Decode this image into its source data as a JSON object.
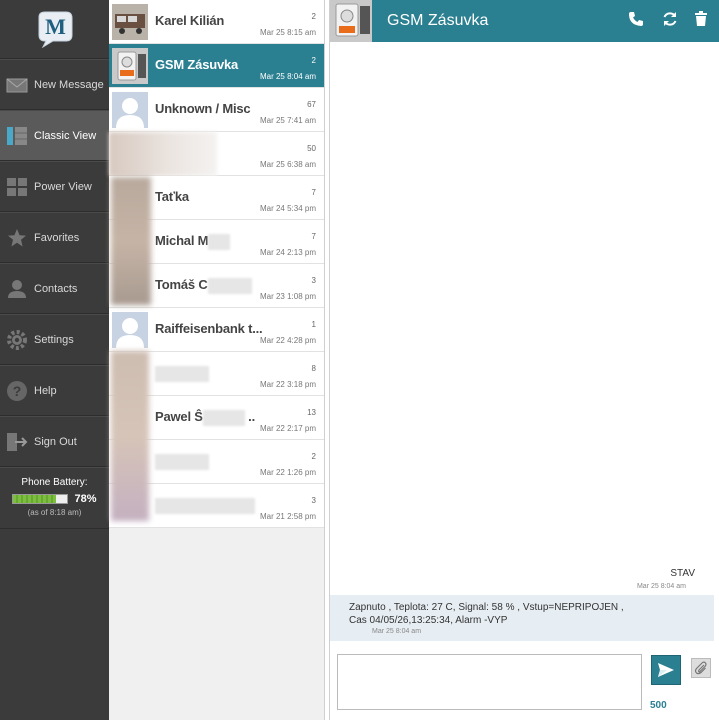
{
  "logo": {
    "letter": "M"
  },
  "nav": {
    "items": [
      {
        "label": "New Message",
        "icon": "envelope-icon"
      },
      {
        "label": "Classic View",
        "icon": "classic-view-icon"
      },
      {
        "label": "Power View",
        "icon": "grid-icon"
      },
      {
        "label": "Favorites",
        "icon": "star-icon"
      },
      {
        "label": "Contacts",
        "icon": "person-icon"
      },
      {
        "label": "Settings",
        "icon": "gear-icon"
      },
      {
        "label": "Help",
        "icon": "help-icon"
      },
      {
        "label": "Sign Out",
        "icon": "sign-out-icon"
      }
    ],
    "active_index": 1
  },
  "battery": {
    "label": "Phone Battery:",
    "percent_text": "78%",
    "level": 0.78,
    "as_of": "(as of 8:18 am)"
  },
  "conversations": [
    {
      "name": "Karel Kilián",
      "count": "2",
      "time": "Mar 25 8:15 am"
    },
    {
      "name": "GSM Zásuvka",
      "count": "2",
      "time": "Mar 25 8:04 am"
    },
    {
      "name": "Unknown / Misc",
      "count": "67",
      "time": "Mar 25 7:41 am"
    },
    {
      "name": "",
      "count": "50",
      "time": "Mar 25 6:38 am"
    },
    {
      "name": "Taťka",
      "count": "7",
      "time": "Mar 24 5:34 pm"
    },
    {
      "name": "Michal M",
      "count": "7",
      "time": "Mar 24 2:13 pm"
    },
    {
      "name": "Tomáš C",
      "count": "3",
      "time": "Mar 23 1:08 pm"
    },
    {
      "name": "Raiffeisenbank t...",
      "count": "1",
      "time": "Mar 22 4:28 pm"
    },
    {
      "name": "",
      "count": "8",
      "time": "Mar 22 3:18 pm"
    },
    {
      "name": "Pawel Ŝ",
      "count": "13",
      "time": "Mar 22 2:17 pm"
    },
    {
      "name": "",
      "count": "2",
      "time": "Mar 22 1:26 pm"
    },
    {
      "name": "",
      "count": "3",
      "time": "Mar 21 2:58 pm"
    }
  ],
  "chat": {
    "title": "GSM Zásuvka",
    "messages": [
      {
        "direction": "out",
        "text": "STAV",
        "time": "Mar 25 8:04 am"
      },
      {
        "direction": "in",
        "line1": "Zapnuto , Teplota: 27 C, Signal: 58 % , Vstup=NEPRIPOJEN ,",
        "line2": "Cas 04/05/26,13:25:34, Alarm -VYP",
        "time": "Mar 25 8:04 am"
      }
    ],
    "composer": {
      "value": "",
      "chars_left": "500"
    }
  },
  "colors": {
    "accent": "#2a7f90",
    "nav_bg": "#3b3b3b",
    "battery_fill": "#7cbf3f"
  }
}
